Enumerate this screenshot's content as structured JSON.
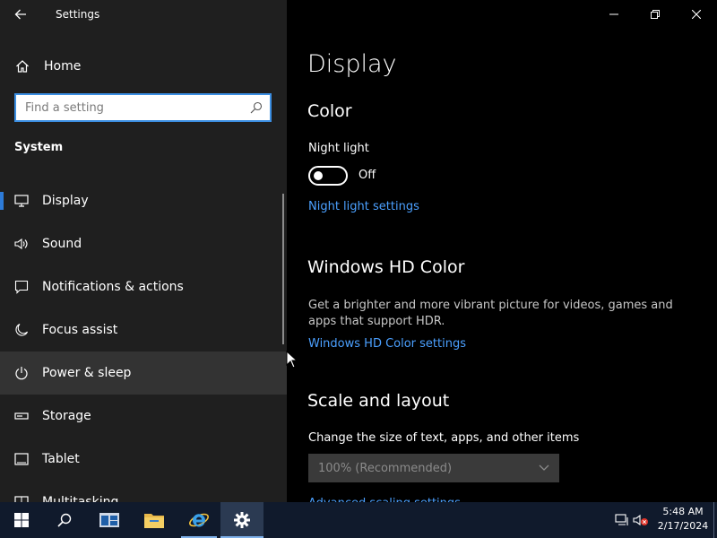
{
  "window": {
    "title": "Settings"
  },
  "sidebar": {
    "home_label": "Home",
    "search_placeholder": "Find a setting",
    "section_title": "System",
    "items": [
      {
        "label": "Display",
        "icon": "monitor-icon",
        "selected": true
      },
      {
        "label": "Sound",
        "icon": "speaker-icon"
      },
      {
        "label": "Notifications & actions",
        "icon": "message-icon"
      },
      {
        "label": "Focus assist",
        "icon": "moon-icon"
      },
      {
        "label": "Power & sleep",
        "icon": "power-icon",
        "hovered": true
      },
      {
        "label": "Storage",
        "icon": "storage-icon"
      },
      {
        "label": "Tablet",
        "icon": "tablet-icon"
      },
      {
        "label": "Multitasking",
        "icon": "multitasking-icon"
      }
    ]
  },
  "main": {
    "page_title": "Display",
    "color": {
      "heading": "Color",
      "night_light_label": "Night light",
      "night_light_state": "Off",
      "night_light_link": "Night light settings"
    },
    "hdr": {
      "heading": "Windows HD Color",
      "description": "Get a brighter and more vibrant picture for videos, games and apps that support HDR.",
      "link": "Windows HD Color settings"
    },
    "scale": {
      "heading": "Scale and layout",
      "change_size_label": "Change the size of text, apps, and other items",
      "selected_value": "100% (Recommended)",
      "advanced_link": "Advanced scaling settings"
    }
  },
  "taskbar": {
    "time": "5:48 AM",
    "date": "2/17/2024"
  },
  "colors": {
    "accent": "#2d7bd8",
    "link": "#4ba0ff",
    "sidebar_bg": "#1f1f1f",
    "main_bg": "#000000",
    "taskbar_bg": "#101a2c"
  }
}
